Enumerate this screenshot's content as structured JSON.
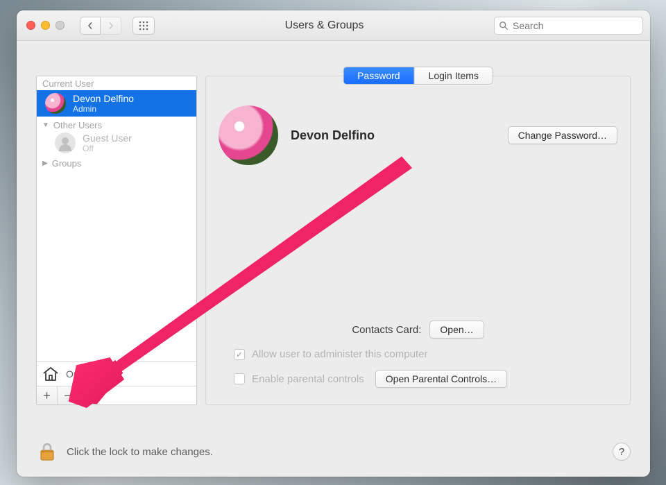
{
  "window": {
    "title": "Users & Groups"
  },
  "search": {
    "placeholder": "Search"
  },
  "sidebar": {
    "current_user_header": "Current User",
    "current": {
      "name": "Devon Delfino",
      "role": "Admin"
    },
    "other_header": "Other Users",
    "guest": {
      "name": "Guest User",
      "status": "Off"
    },
    "groups_header": "Groups",
    "login_options": "Options"
  },
  "tabs": {
    "password": "Password",
    "login_items": "Login Items"
  },
  "main": {
    "name": "Devon Delfino",
    "change_password": "Change Password…",
    "contacts_label": "Contacts Card:",
    "open": "Open…",
    "admin_check": "Allow user to administer this computer",
    "parental_check": "Enable parental controls",
    "open_parental": "Open Parental Controls…"
  },
  "footer": {
    "message": "Click the lock to make changes.",
    "help": "?"
  }
}
